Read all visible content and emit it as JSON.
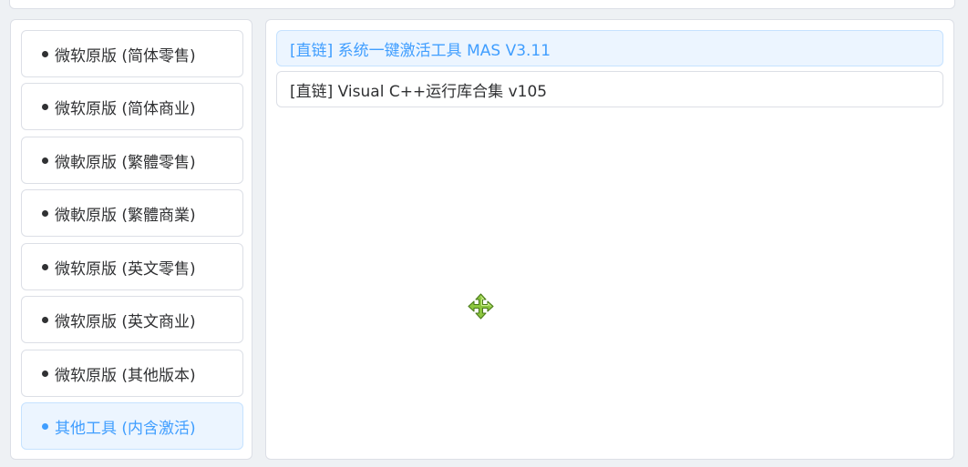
{
  "categories": [
    {
      "label": "微软原版 (简体零售)",
      "active": false
    },
    {
      "label": "微软原版 (简体商业)",
      "active": false
    },
    {
      "label": "微軟原版 (繁體零售)",
      "active": false
    },
    {
      "label": "微軟原版 (繁體商業)",
      "active": false
    },
    {
      "label": "微软原版 (英文零售)",
      "active": false
    },
    {
      "label": "微软原版 (英文商业)",
      "active": false
    },
    {
      "label": "微软原版 (其他版本)",
      "active": false
    },
    {
      "label": "其他工具 (内含激活)",
      "active": true
    }
  ],
  "links": [
    {
      "label": "[直链] 系统一键激活工具 MAS V3.11",
      "active": true
    },
    {
      "label": "[直链] Visual C++运行库合集 v105",
      "active": false
    }
  ],
  "colors": {
    "accent": "#409eff",
    "accent_bg": "#ecf5ff",
    "text": "#303133",
    "border": "#dcdfe6",
    "cursor_fill": "#8cc63f"
  },
  "cursor_icon": "move-cursor-icon"
}
